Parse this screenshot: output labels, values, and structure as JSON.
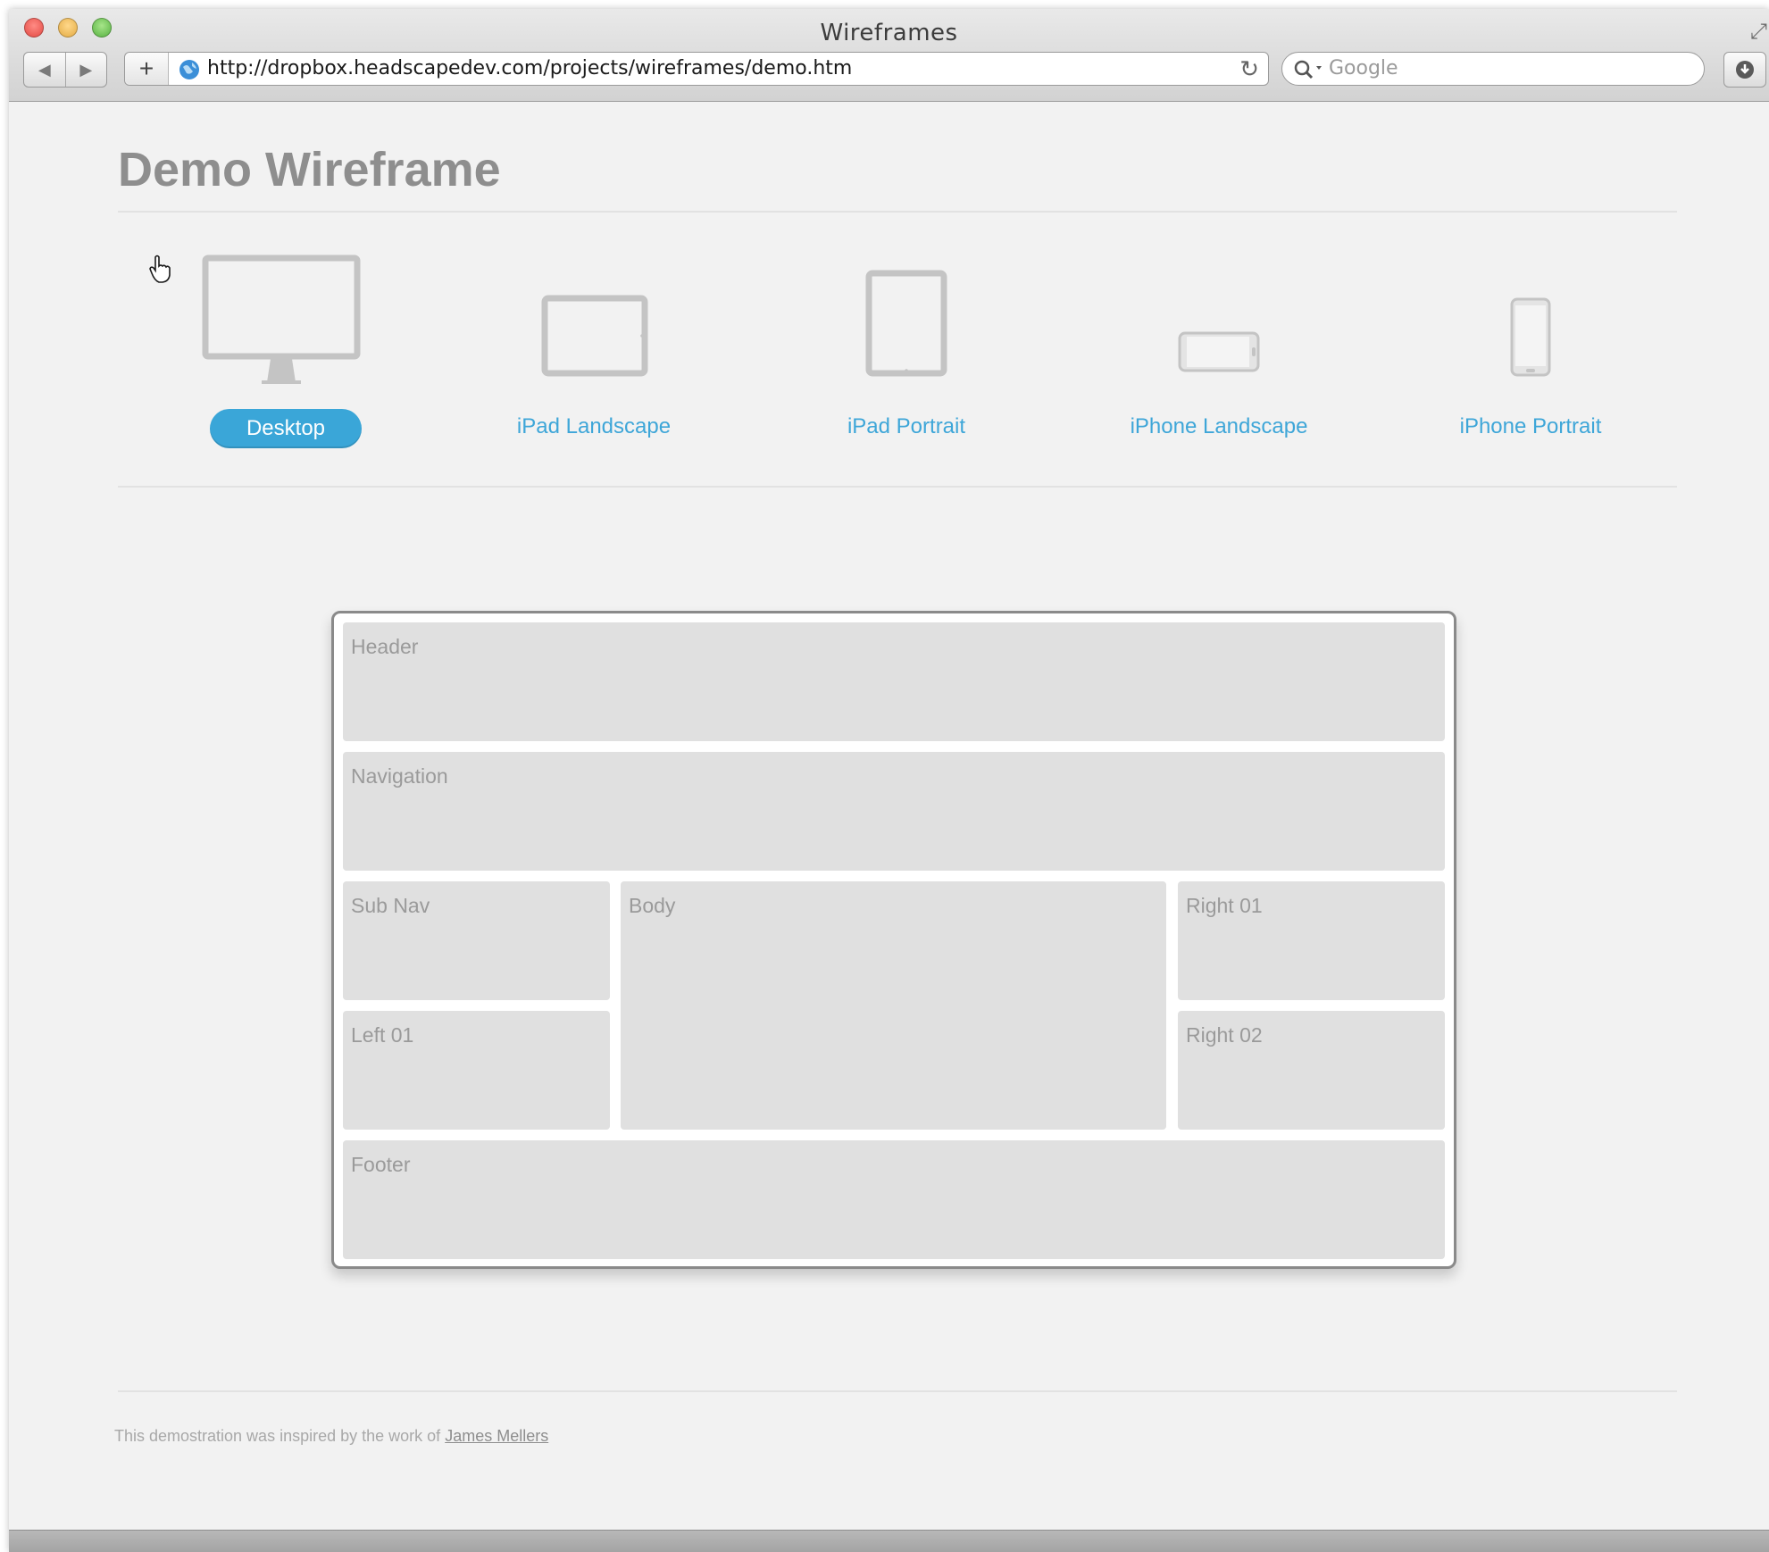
{
  "window": {
    "title": "Wireframes"
  },
  "toolbar": {
    "back_icon": "back-arrow-icon",
    "forward_icon": "forward-arrow-icon",
    "add_label": "+",
    "url": "http://dropbox.headscapedev.com/projects/wireframes/demo.htm",
    "search_placeholder": "Google"
  },
  "page": {
    "title": "Demo Wireframe",
    "devices": [
      {
        "label": "Desktop",
        "icon": "desktop-monitor-icon",
        "selected": true
      },
      {
        "label": "iPad Landscape",
        "icon": "ipad-landscape-icon",
        "selected": false
      },
      {
        "label": "iPad Portrait",
        "icon": "ipad-portrait-icon",
        "selected": false
      },
      {
        "label": "iPhone Landscape",
        "icon": "iphone-landscape-icon",
        "selected": false
      },
      {
        "label": "iPhone Portrait",
        "icon": "iphone-portrait-icon",
        "selected": false
      }
    ],
    "wireframe": {
      "header": "Header",
      "navigation": "Navigation",
      "sub_nav": "Sub Nav",
      "body": "Body",
      "right_01": "Right 01",
      "left_01": "Left 01",
      "right_02": "Right 02",
      "footer": "Footer"
    },
    "footer_text": "This demostration was inspired by the work of",
    "footer_link": "James Mellers"
  },
  "colors": {
    "accent": "#3aa6d8",
    "title_gray": "#8e8e8e",
    "block_fill": "#e0e0e0"
  }
}
